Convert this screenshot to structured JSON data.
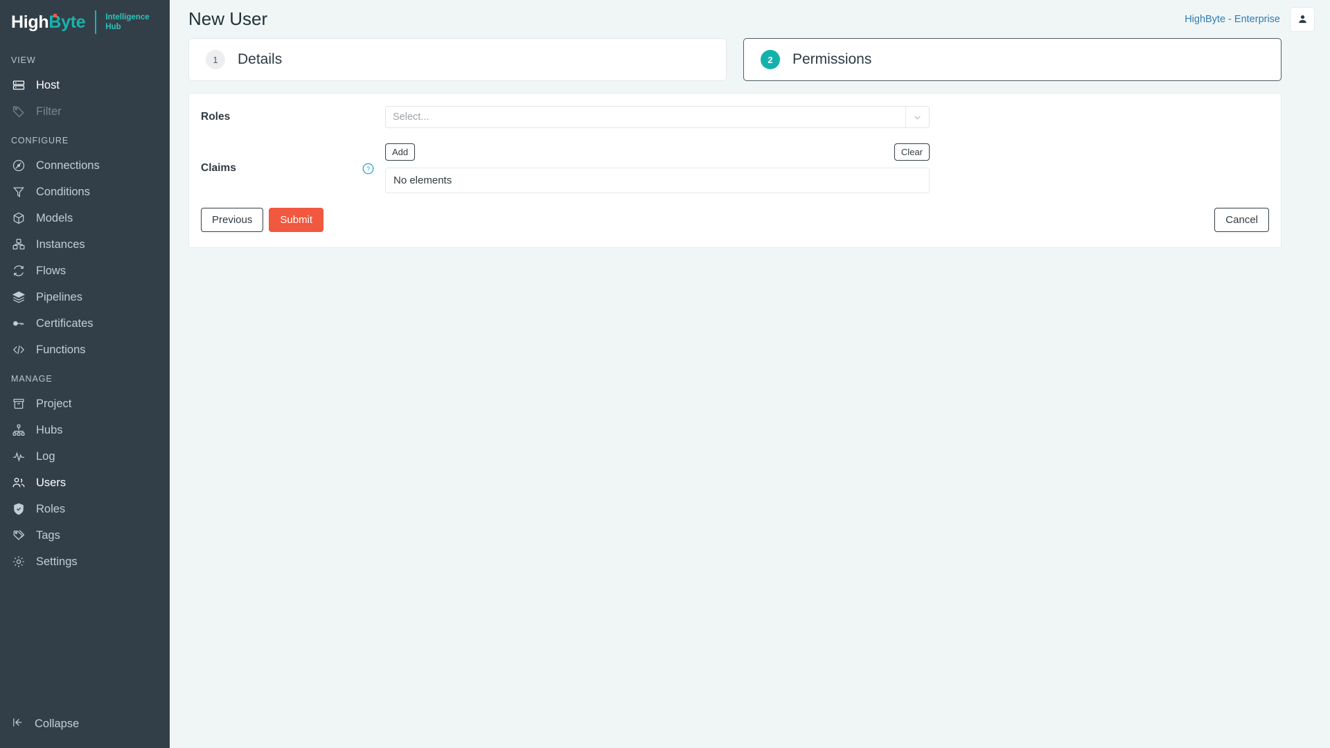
{
  "brand": {
    "name_part1": "High",
    "name_part2": "Byte",
    "sub_line1": "Intelligence",
    "sub_line2": "Hub",
    "accent_teal": "#13b1ab",
    "accent_orange": "#f0583f",
    "sidebar_bg": "#333f48"
  },
  "sidebar": {
    "sections": [
      {
        "title": "VIEW",
        "items": [
          {
            "label": "Host",
            "icon": "server-icon",
            "state": "active"
          },
          {
            "label": "Filter",
            "icon": "tag-icon",
            "state": "muted"
          }
        ]
      },
      {
        "title": "CONFIGURE",
        "items": [
          {
            "label": "Connections",
            "icon": "connection-icon",
            "state": "normal"
          },
          {
            "label": "Conditions",
            "icon": "funnel-icon",
            "state": "normal"
          },
          {
            "label": "Models",
            "icon": "box-icon",
            "state": "normal"
          },
          {
            "label": "Instances",
            "icon": "boxes-icon",
            "state": "normal"
          },
          {
            "label": "Flows",
            "icon": "refresh-icon",
            "state": "normal"
          },
          {
            "label": "Pipelines",
            "icon": "layers-icon",
            "state": "normal"
          },
          {
            "label": "Certificates",
            "icon": "key-icon",
            "state": "normal"
          },
          {
            "label": "Functions",
            "icon": "code-icon",
            "state": "normal"
          }
        ]
      },
      {
        "title": "MANAGE",
        "items": [
          {
            "label": "Project",
            "icon": "archive-icon",
            "state": "normal"
          },
          {
            "label": "Hubs",
            "icon": "network-icon",
            "state": "normal"
          },
          {
            "label": "Log",
            "icon": "activity-icon",
            "state": "normal"
          },
          {
            "label": "Users",
            "icon": "users-icon",
            "state": "active"
          },
          {
            "label": "Roles",
            "icon": "shield-check-icon",
            "state": "normal"
          },
          {
            "label": "Tags",
            "icon": "tags-icon",
            "state": "normal"
          },
          {
            "label": "Settings",
            "icon": "gear-icon",
            "state": "normal"
          }
        ]
      }
    ],
    "collapse_label": "Collapse",
    "collapse_icon": "collapse-left-icon"
  },
  "header": {
    "title": "New User",
    "enterprise_label": "HighByte - Enterprise",
    "avatar_icon": "user-icon"
  },
  "steps": [
    {
      "number": "1",
      "label": "Details",
      "active": false
    },
    {
      "number": "2",
      "label": "Permissions",
      "active": true
    }
  ],
  "form": {
    "roles": {
      "label": "Roles",
      "placeholder": "Select...",
      "value": "",
      "dropdown_icon": "chevron-down-icon"
    },
    "claims": {
      "label": "Claims",
      "help_icon": "question-circle-icon",
      "add_label": "Add",
      "clear_label": "Clear",
      "empty_text": "No elements"
    }
  },
  "actions": {
    "previous_label": "Previous",
    "submit_label": "Submit",
    "cancel_label": "Cancel"
  }
}
